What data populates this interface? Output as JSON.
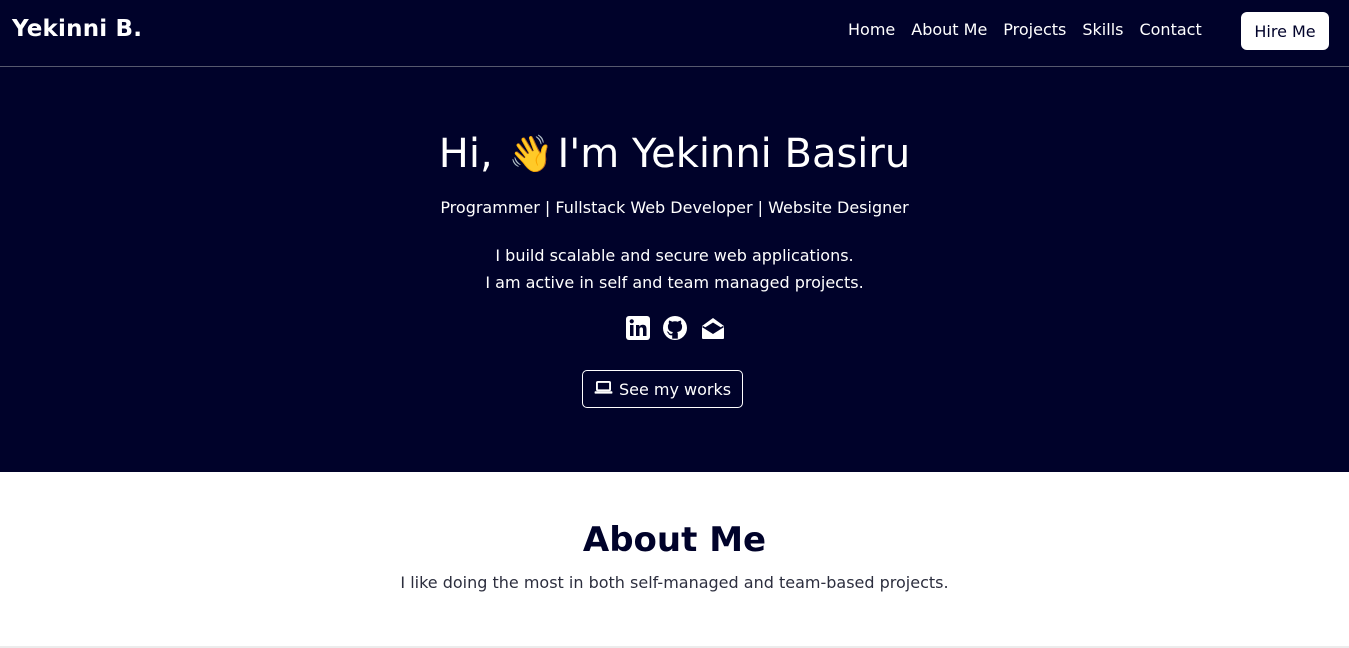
{
  "nav": {
    "brand": "Yekinni B.",
    "links": [
      "Home",
      "About Me",
      "Projects",
      "Skills",
      "Contact"
    ],
    "hire_label": "Hire Me"
  },
  "hero": {
    "greeting": "Hi,",
    "wave_emoji": "👋",
    "name_line": "I'm Yekinni Basiru",
    "roles": "Programmer | Fullstack Web Developer | Website Designer",
    "desc_line1": "I build scalable and secure web applications.",
    "desc_line2": "I am active in self and team managed projects.",
    "social_icons": [
      "linkedin-icon",
      "github-icon",
      "envelope-open-icon"
    ],
    "works_label": "See my works",
    "works_icon": "laptop-icon"
  },
  "about": {
    "title": "About Me",
    "text": "I like doing the most in both self-managed and team-based projects."
  },
  "colors": {
    "navy": "#00022a",
    "white": "#ffffff"
  }
}
